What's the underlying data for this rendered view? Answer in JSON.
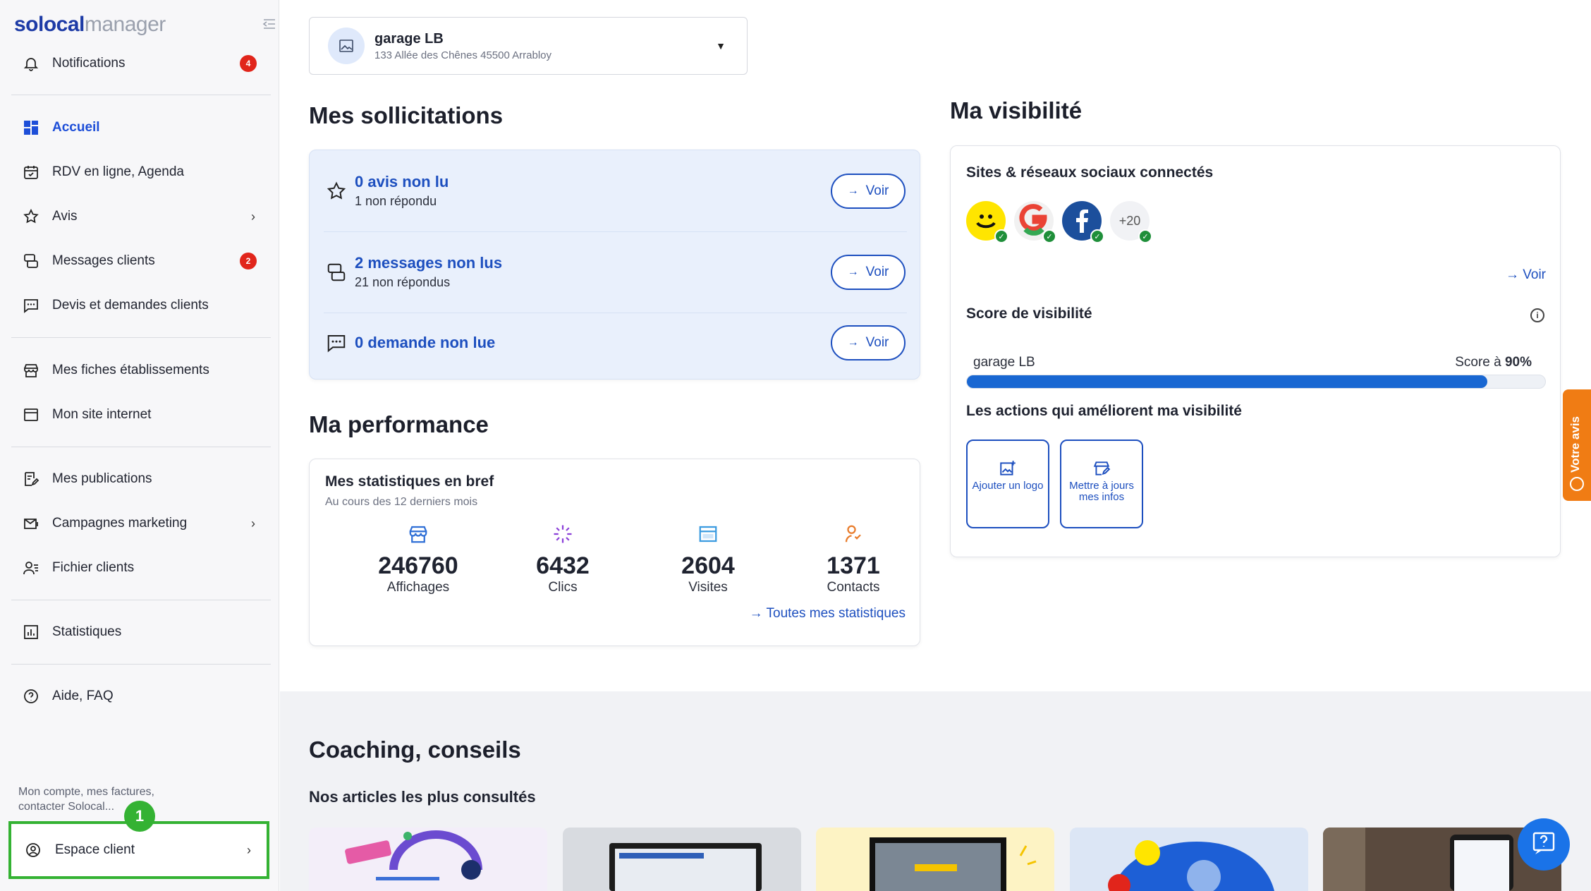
{
  "brand": {
    "part1": "solocal",
    "part2": "manager"
  },
  "sidebar": {
    "items": [
      {
        "label": "Notifications",
        "badge": "4"
      },
      {
        "label": "Accueil"
      },
      {
        "label": "RDV en ligne, Agenda"
      },
      {
        "label": "Avis"
      },
      {
        "label": "Messages clients",
        "badge": "2"
      },
      {
        "label": "Devis et demandes clients"
      },
      {
        "label": "Mes fiches établissements"
      },
      {
        "label": "Mon site internet"
      },
      {
        "label": "Mes publications"
      },
      {
        "label": "Campagnes marketing"
      },
      {
        "label": "Fichier clients"
      },
      {
        "label": "Statistiques"
      },
      {
        "label": "Aide, FAQ"
      }
    ],
    "account_hint": "Mon compte, mes factures, contacter Solocal...",
    "client_space": "Espace client",
    "step_number": "1"
  },
  "selector": {
    "name": "garage LB",
    "address": "133 Allée des Chênes 45500 Arrabloy"
  },
  "solicitations": {
    "title": "Mes sollicitations",
    "rows": [
      {
        "title": "0 avis non lu",
        "subtitle": "1 non répondu",
        "button": "Voir"
      },
      {
        "title": "2 messages non lus",
        "subtitle": "21 non répondus",
        "button": "Voir"
      },
      {
        "title": "0 demande non lue",
        "subtitle": "",
        "button": "Voir"
      }
    ]
  },
  "performance": {
    "title": "Ma performance",
    "card_title": "Mes statistiques en bref",
    "card_subtitle": "Au cours des 12 derniers mois",
    "stats": [
      {
        "value": "246760",
        "label": "Affichages"
      },
      {
        "value": "6432",
        "label": "Clics"
      },
      {
        "value": "2604",
        "label": "Visites"
      },
      {
        "value": "1371",
        "label": "Contacts"
      }
    ],
    "all_stats_link": "Toutes mes statistiques"
  },
  "visibility": {
    "title": "Ma visibilité",
    "networks_title": "Sites & réseaux sociaux connectés",
    "more_networks": "+20",
    "voir": "Voir",
    "score_title": "Score de visibilité",
    "score_name": "garage LB",
    "score_prefix": "Score à",
    "score_value": "90%",
    "score_fraction": 0.9,
    "actions_title": "Les actions qui améliorent ma visibilité",
    "actions": [
      "Ajouter un logo",
      "Mettre à jours mes infos"
    ]
  },
  "coaching": {
    "title": "Coaching, conseils",
    "subtitle": "Nos articles les plus consultés"
  },
  "feedback_tab": "Votre avis",
  "colors": {
    "primary": "#1d4fbf",
    "badge": "#e1251b",
    "highlight": "#34b233",
    "feedback": "#f07c14"
  }
}
